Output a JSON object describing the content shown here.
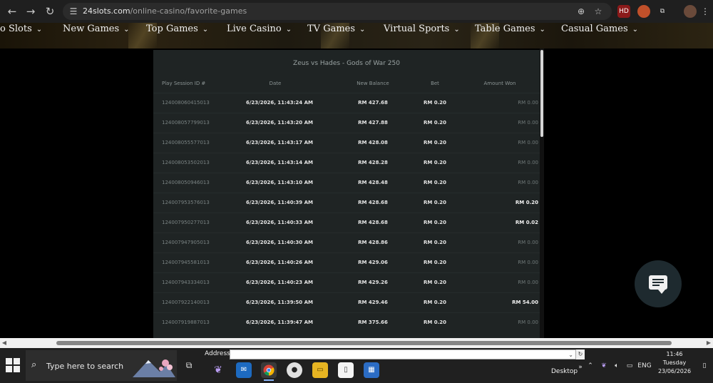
{
  "browser": {
    "url_host": "24slots.com",
    "url_path": "/online-casino/favorite-games",
    "extensions": [
      "HD"
    ]
  },
  "site_nav": {
    "items": [
      {
        "label": "o Slots"
      },
      {
        "label": "New Games"
      },
      {
        "label": "Top Games"
      },
      {
        "label": "Live Casino"
      },
      {
        "label": "TV Games"
      },
      {
        "label": "Virtual Sports"
      },
      {
        "label": "Table Games"
      },
      {
        "label": "Casual Games"
      }
    ]
  },
  "panel": {
    "title": "Zeus vs Hades - Gods of War 250",
    "columns": [
      "Play Session ID #",
      "Date",
      "New Balance",
      "Bet",
      "Amount Won"
    ],
    "rows": [
      {
        "id": "124008060415013",
        "date": "6/23/2026, 11:43:24 AM",
        "balance": "RM 427.68",
        "bet": "RM 0.20",
        "won": "RM 0.00",
        "highlight": false
      },
      {
        "id": "124008057799013",
        "date": "6/23/2026, 11:43:20 AM",
        "balance": "RM 427.88",
        "bet": "RM 0.20",
        "won": "RM 0.00",
        "highlight": false
      },
      {
        "id": "124008055577013",
        "date": "6/23/2026, 11:43:17 AM",
        "balance": "RM 428.08",
        "bet": "RM 0.20",
        "won": "RM 0.00",
        "highlight": false
      },
      {
        "id": "124008053502013",
        "date": "6/23/2026, 11:43:14 AM",
        "balance": "RM 428.28",
        "bet": "RM 0.20",
        "won": "RM 0.00",
        "highlight": false
      },
      {
        "id": "124008050946013",
        "date": "6/23/2026, 11:43:10 AM",
        "balance": "RM 428.48",
        "bet": "RM 0.20",
        "won": "RM 0.00",
        "highlight": false
      },
      {
        "id": "124007953576013",
        "date": "6/23/2026, 11:40:39 AM",
        "balance": "RM 428.68",
        "bet": "RM 0.20",
        "won": "RM 0.20",
        "highlight": true
      },
      {
        "id": "124007950277013",
        "date": "6/23/2026, 11:40:33 AM",
        "balance": "RM 428.68",
        "bet": "RM 0.20",
        "won": "RM 0.02",
        "highlight": true
      },
      {
        "id": "124007947905013",
        "date": "6/23/2026, 11:40:30 AM",
        "balance": "RM 428.86",
        "bet": "RM 0.20",
        "won": "RM 0.00",
        "highlight": false
      },
      {
        "id": "124007945581013",
        "date": "6/23/2026, 11:40:26 AM",
        "balance": "RM 429.06",
        "bet": "RM 0.20",
        "won": "RM 0.00",
        "highlight": false
      },
      {
        "id": "124007943334013",
        "date": "6/23/2026, 11:40:23 AM",
        "balance": "RM 429.26",
        "bet": "RM 0.20",
        "won": "RM 0.00",
        "highlight": false
      },
      {
        "id": "124007922140013",
        "date": "6/23/2026, 11:39:50 AM",
        "balance": "RM 429.46",
        "bet": "RM 0.20",
        "won": "RM 54.00",
        "highlight": true
      },
      {
        "id": "124007919887013",
        "date": "6/23/2026, 11:39:47 AM",
        "balance": "RM 375.66",
        "bet": "RM 0.20",
        "won": "RM 0.00",
        "highlight": false
      }
    ]
  },
  "taskbar": {
    "search_placeholder": "Type here to search",
    "address_label": "Address",
    "address_value": "",
    "desktop_label": "Desktop",
    "language": "ENG",
    "time": "11:46",
    "day": "Tuesday",
    "date": "23/06/2026"
  },
  "colors": {
    "panel_bg": "#1f2424",
    "chat_bubble": "#1e2a2f"
  }
}
